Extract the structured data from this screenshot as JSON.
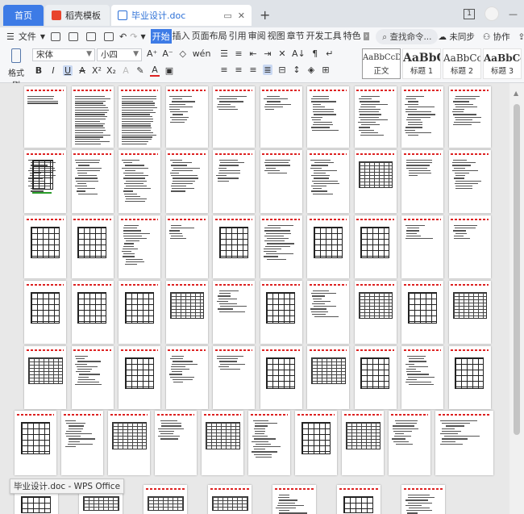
{
  "tabs": {
    "home": "首页",
    "templates": "稻壳模板",
    "document": "毕业设计.doc",
    "new_tab": "+"
  },
  "window": {
    "badge": "1"
  },
  "menu": {
    "file": "文件",
    "items": [
      "开始",
      "插入",
      "页面布局",
      "引用",
      "审阅",
      "视图",
      "章节",
      "开发工具",
      "特色"
    ],
    "active_index": 0,
    "search": "查找命令...",
    "sync": "未同步",
    "collaborate": "协作",
    "share": "分享"
  },
  "toolbar": {
    "format_painter": "格式刷",
    "font_name": "宋体",
    "font_size": "小四",
    "styles": [
      {
        "sample": "AaBbCcDc",
        "name": "正文"
      },
      {
        "sample": "AaBbC",
        "name": "标题 1"
      },
      {
        "sample": "AaBbCc",
        "name": "标题 2"
      },
      {
        "sample": "AaBbCcI",
        "name": "标题 3"
      }
    ]
  },
  "tooltip": "毕业设计.doc - WPS Office",
  "colors": {
    "accent": "#3d7be6",
    "header_red": "#dd2222",
    "background": "#e8e8e8"
  }
}
